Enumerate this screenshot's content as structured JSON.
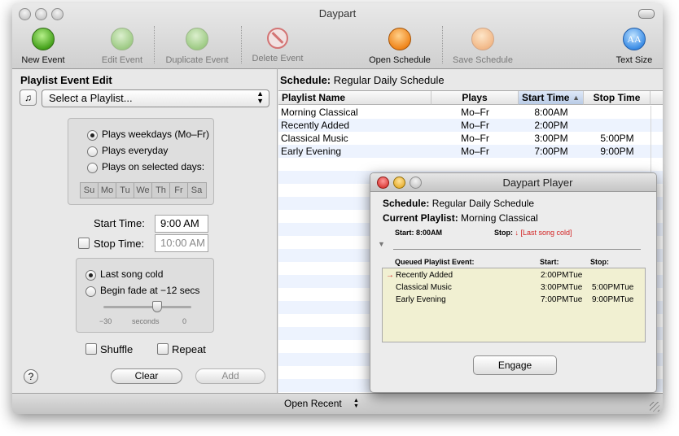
{
  "window": {
    "title": "Daypart"
  },
  "toolbar": {
    "new_event": "New Event",
    "edit_event": "Edit Event",
    "duplicate_event": "Duplicate Event",
    "delete_event": "Delete Event",
    "open_schedule": "Open Schedule",
    "save_schedule": "Save Schedule",
    "text_size": "Text Size",
    "text_size_glyph": "AA"
  },
  "left": {
    "heading": "Playlist Event Edit",
    "playlist_select": "Select a Playlist...",
    "music_icon": "♫",
    "radio_weekdays": "Plays weekdays (Mo–Fr)",
    "radio_everyday": "Plays everyday",
    "radio_selected": "Plays on selected days:",
    "days": [
      "Su",
      "Mo",
      "Tu",
      "We",
      "Th",
      "Fr",
      "Sa"
    ],
    "start_label": "Start Time:",
    "start_value": "9:00 AM",
    "stop_label": "Stop Time:",
    "stop_value": "10:00 AM",
    "last_song_cold": "Last song cold",
    "begin_fade": "Begin fade at −12 secs",
    "slider_min": "−30",
    "slider_unit": "seconds",
    "slider_max": "0",
    "slider_fraction": 0.6,
    "shuffle": "Shuffle",
    "repeat": "Repeat",
    "help": "?",
    "clear": "Clear",
    "add": "Add"
  },
  "schedule": {
    "label": "Schedule:",
    "name": "Regular Daily Schedule",
    "columns": [
      "Playlist Name",
      "Plays",
      "Start Time",
      "Stop Time"
    ],
    "sort_indicator": "▲",
    "rows": [
      [
        "Morning Classical",
        "Mo–Fr",
        "8:00AM",
        ""
      ],
      [
        "Recently Added",
        "Mo–Fr",
        "2:00PM",
        ""
      ],
      [
        "Classical Music",
        "Mo–Fr",
        "3:00PM",
        "5:00PM"
      ],
      [
        "Early Evening",
        "Mo–Fr",
        "7:00PM",
        "9:00PM"
      ]
    ]
  },
  "bottombar": {
    "open_recent": "Open Recent"
  },
  "player": {
    "title": "Daypart Player",
    "schedule_label": "Schedule:",
    "schedule_value": "Regular Daily Schedule",
    "current_label": "Current Playlist:",
    "current_value": "Morning Classical",
    "start_label": "Start:",
    "start_value": "8:00AM",
    "stop_label": "Stop:",
    "stop_value": "↓ [Last song cold]",
    "queue_headers": [
      "Queued Playlist Event:",
      "Start:",
      "Stop:"
    ],
    "queue_rows": [
      {
        "marker": "→",
        "name": "Recently Added",
        "start": "2:00PMTue",
        "stop": ""
      },
      {
        "marker": "",
        "name": "Classical Music",
        "start": "3:00PMTue",
        "stop": "5:00PMTue"
      },
      {
        "marker": "",
        "name": "Early Evening",
        "start": "7:00PMTue",
        "stop": "9:00PMTue"
      }
    ],
    "engage": "Engage"
  },
  "colors": {
    "accent_red": "#d22222",
    "queue_bg": "#f1f0d2",
    "row_alt": "#edf3fe"
  }
}
